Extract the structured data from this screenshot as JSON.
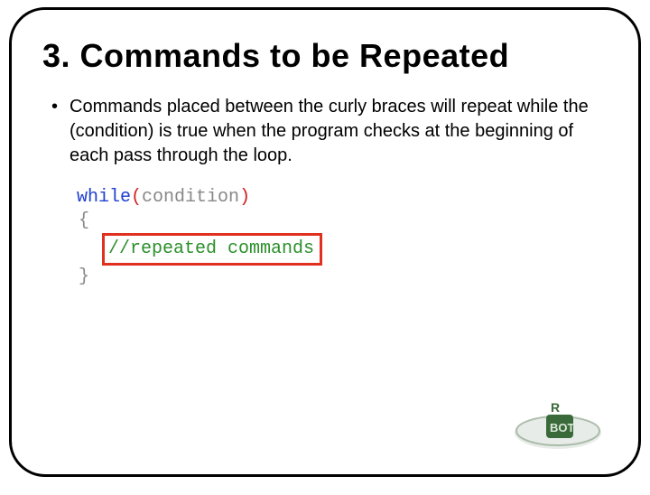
{
  "title": "3. Commands to be Repeated",
  "bullet": "Commands placed between the curly braces will repeat while the (condition) is true when the program checks at the beginning of each pass through the loop.",
  "code": {
    "while": "while",
    "lparen": "(",
    "condition": "condition",
    "rparen": ")",
    "lbrace": "{",
    "comment": "//repeated commands",
    "rbrace": "}"
  },
  "logo": {
    "top": "R",
    "bottom": "BOT"
  }
}
